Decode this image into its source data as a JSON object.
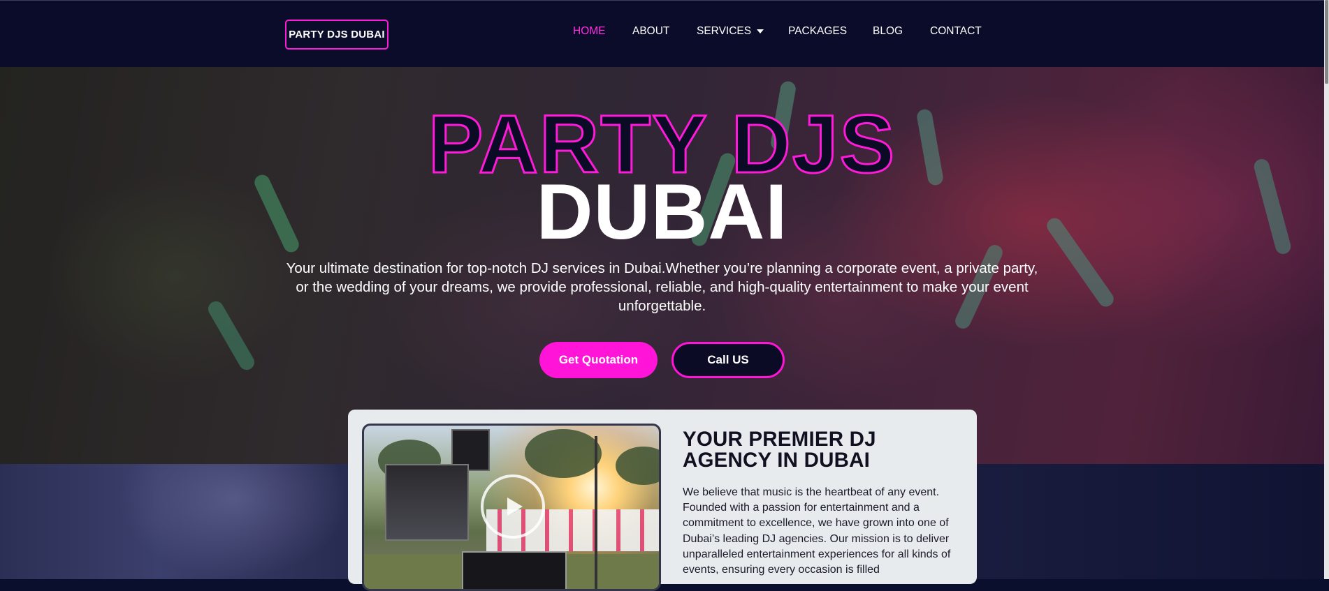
{
  "header": {
    "logo_text": "PARTY DJS DUBAI",
    "nav": [
      {
        "label": "HOME",
        "active": true
      },
      {
        "label": "ABOUT",
        "active": false
      },
      {
        "label": "SERVICES",
        "active": false,
        "has_dropdown": true
      },
      {
        "label": "PACKAGES",
        "active": false
      },
      {
        "label": "BLOG",
        "active": false
      },
      {
        "label": "CONTACT",
        "active": false
      }
    ]
  },
  "hero": {
    "title_line1": "PARTY DJS",
    "title_line2": "DUBAI",
    "description": "Your ultimate destination for top-notch DJ services in Dubai.Whether you’re planning a corporate event, a private party, or the wedding of your dreams, we provide professional, reliable, and high-quality entertainment to make your event unforgettable.",
    "primary_button": "Get Quotation",
    "secondary_button": "Call US"
  },
  "about": {
    "title": "YOUR PREMIER DJ AGENCY IN DUBAI",
    "text": "We believe that music is the heartbeat of any event. Founded with a passion for entertainment and a commitment to excellence, we have grown into one of Dubai’s leading DJ agencies. Our mission is to deliver unparalleled entertainment experiences for all kinds of events, ensuring every occasion is filled",
    "video_icon": "play-icon"
  },
  "colors": {
    "accent": "#ff14d8",
    "nav_bg": "#0a0c2a",
    "card_bg": "#e8ebee"
  }
}
